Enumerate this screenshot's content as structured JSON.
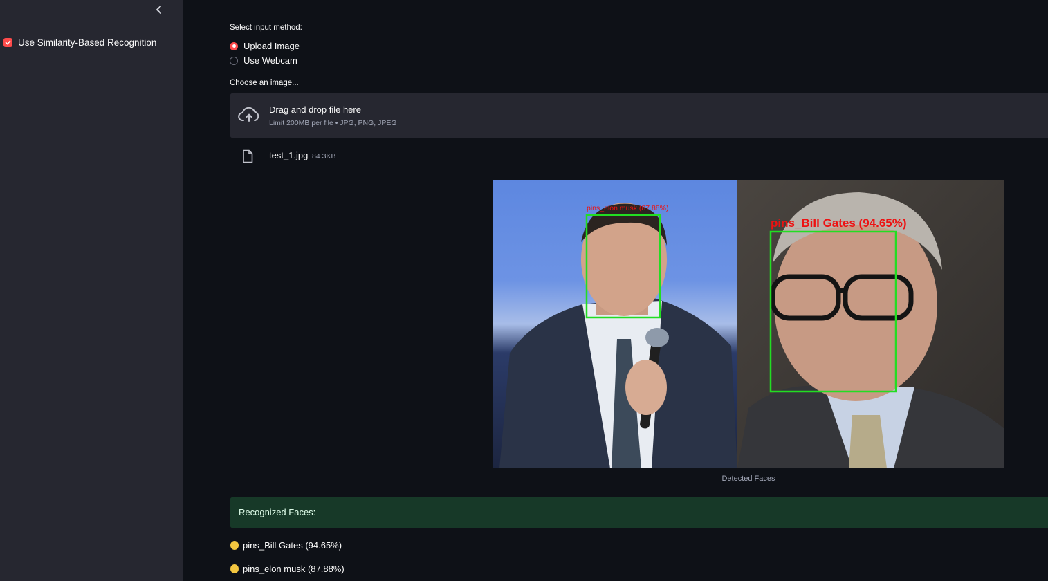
{
  "sidebar": {
    "collapse_icon": "chevron-left-icon",
    "checkbox_label": "Use Similarity-Based Recognition",
    "checkbox_checked": true
  },
  "main": {
    "input_method_label": "Select input method:",
    "radio_options": [
      {
        "label": "Upload Image",
        "selected": true
      },
      {
        "label": "Use Webcam",
        "selected": false
      }
    ],
    "uploader_label": "Choose an image...",
    "dropzone": {
      "icon": "cloud-upload-icon",
      "title": "Drag and drop file here",
      "subtitle": "Limit 200MB per file • JPG, PNG, JPEG"
    },
    "file": {
      "icon": "file-icon",
      "name": "test_1.jpg",
      "size": "84.3KB"
    },
    "image": {
      "detections": [
        {
          "label": "pins_elon musk (87.88%)"
        },
        {
          "label": "pins_Bill Gates (94.65%)"
        }
      ],
      "caption": "Detected Faces"
    },
    "success_label": "Recognized Faces:",
    "faces": [
      {
        "icon": "face-emoji-icon",
        "label": "pins_Bill Gates (94.65%)"
      },
      {
        "icon": "face-emoji-icon",
        "label": "pins_elon musk (87.88%)"
      }
    ]
  },
  "colors": {
    "accent": "#ff4b4b",
    "background": "#0e1117",
    "sidebar": "#262730",
    "success_bg": "#173928",
    "box_green": "#22dd22",
    "label_red": "#ee1111"
  }
}
